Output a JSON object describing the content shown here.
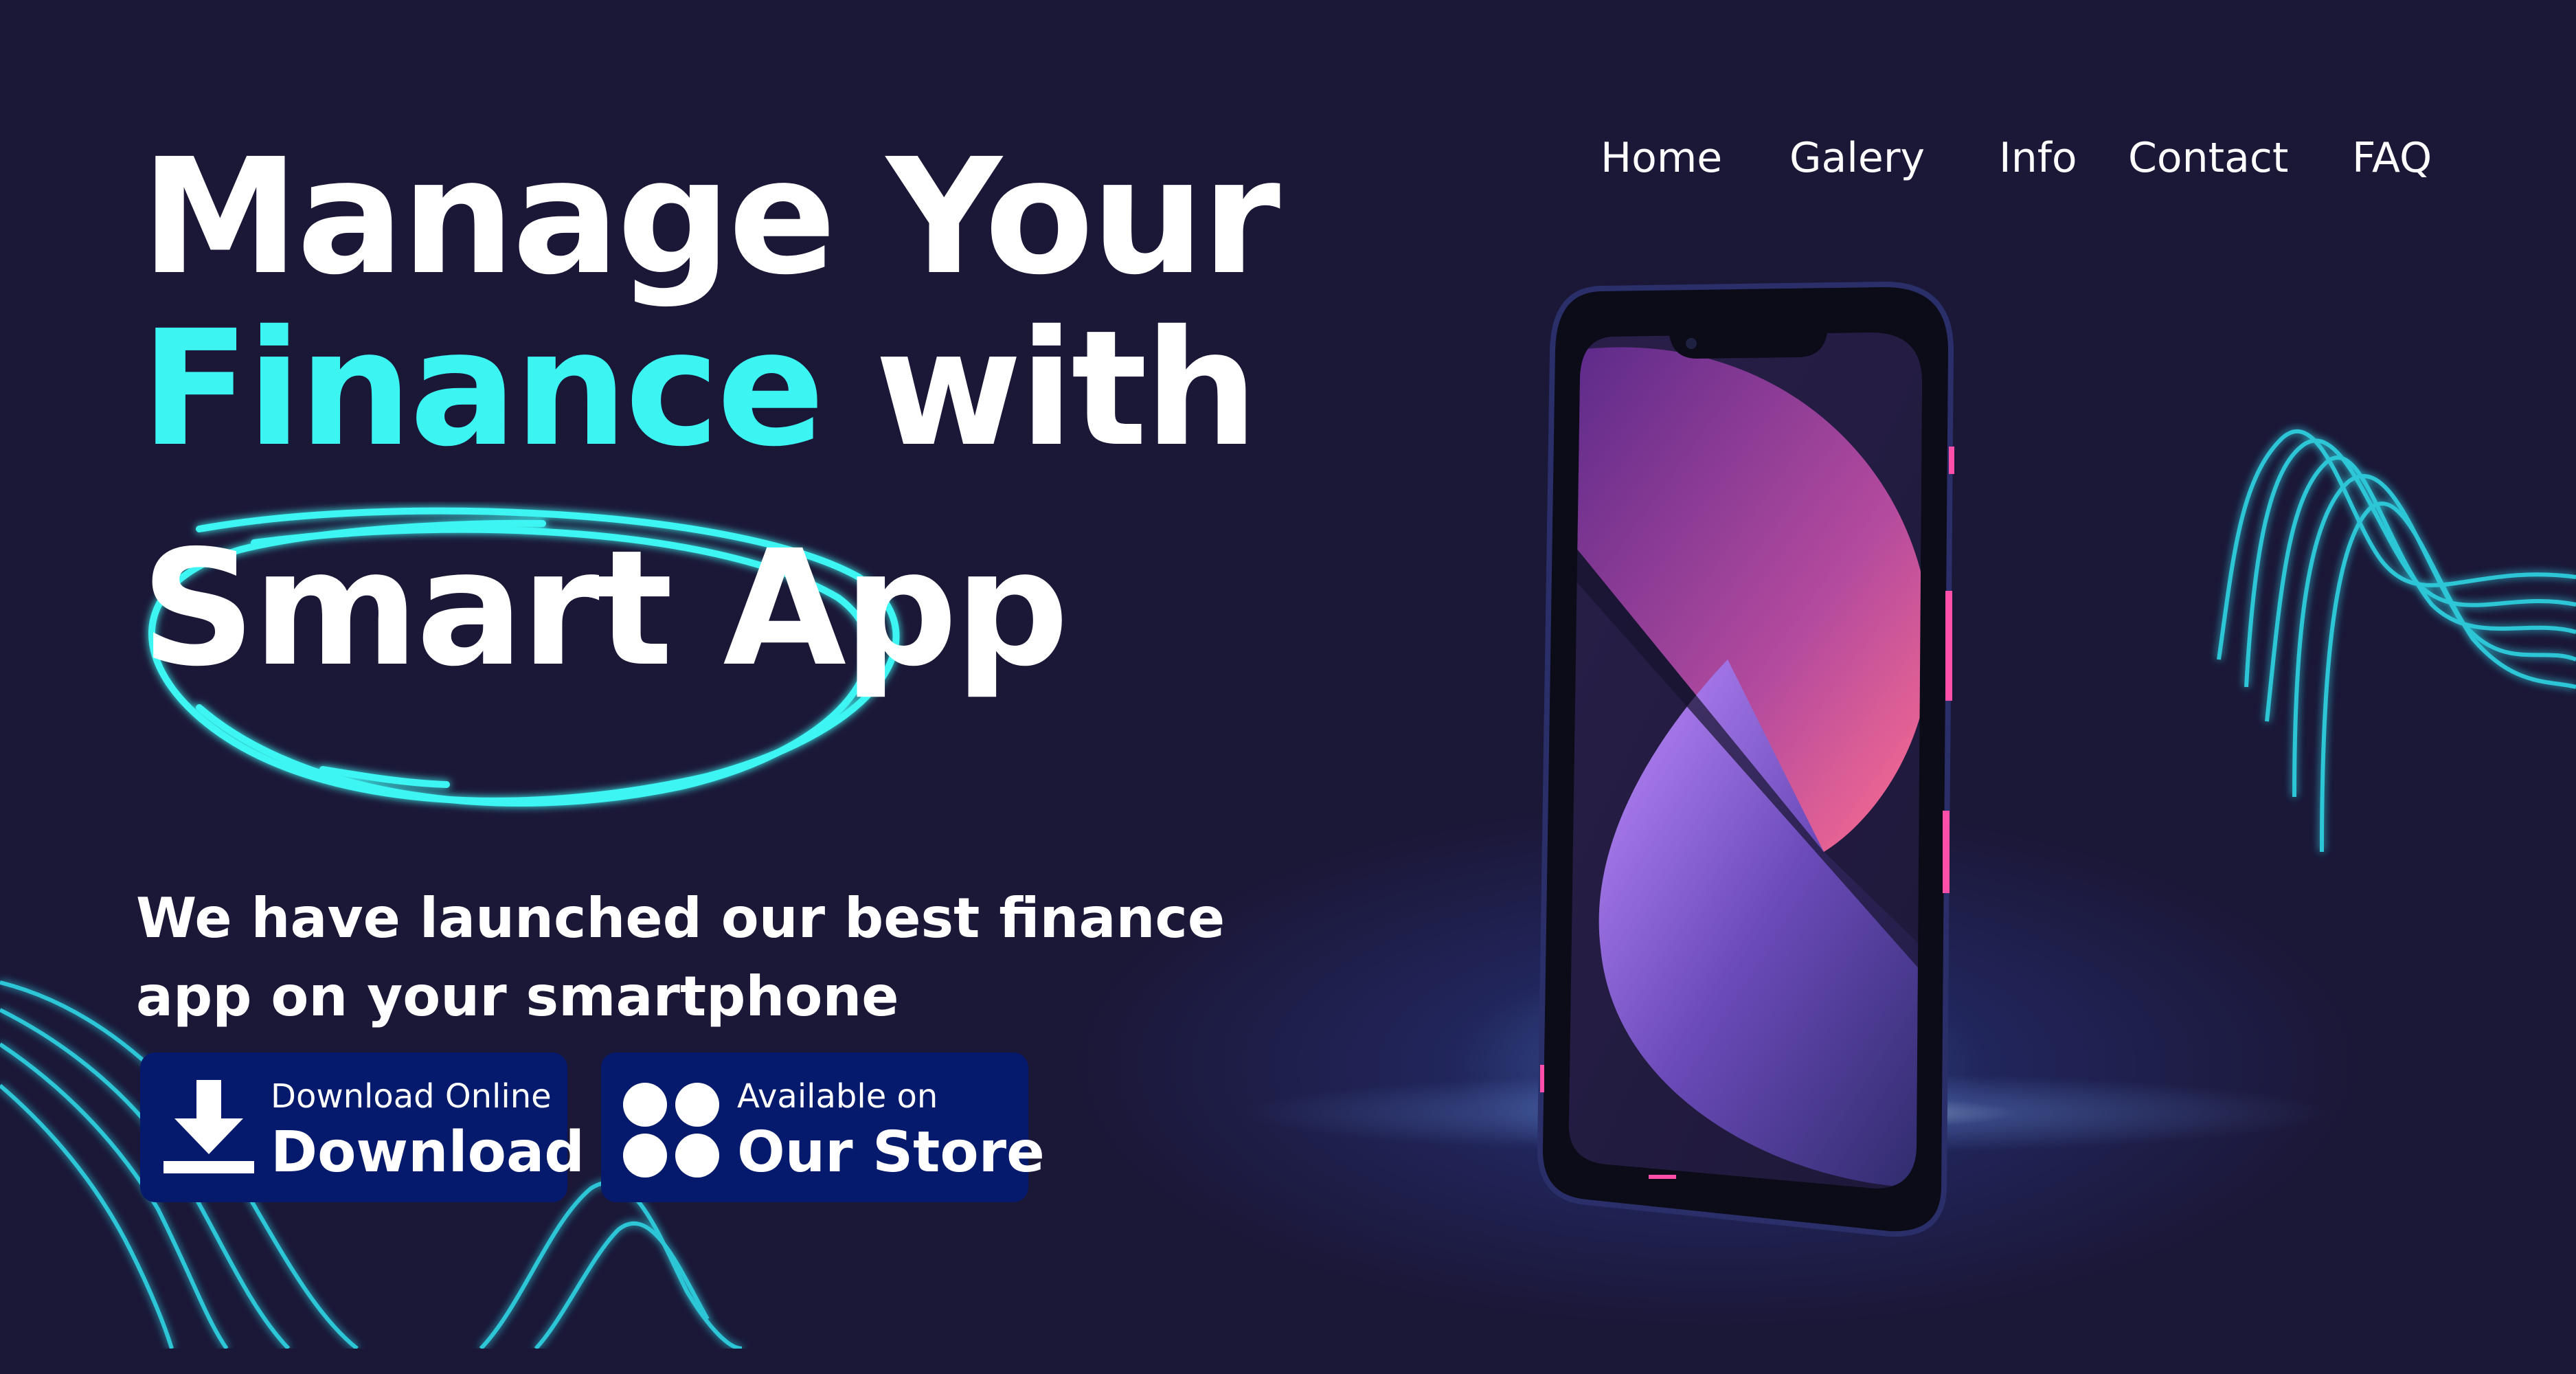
{
  "nav": {
    "items": [
      {
        "label": "Home"
      },
      {
        "label": "Galery"
      },
      {
        "label": "Info"
      },
      {
        "label": "Contact"
      },
      {
        "label": "FAQ"
      }
    ]
  },
  "hero": {
    "line1": "Manage Your",
    "line2_accent": "Finance",
    "line2_rest": " with",
    "line3": "Smart App",
    "subtitle_line1": "We have launched our best finance",
    "subtitle_line2": "app on your smartphone"
  },
  "buttons": {
    "download": {
      "small": "Download Online",
      "big": "Download",
      "icon": "download-icon"
    },
    "store": {
      "small": "Available on",
      "big": "Our Store",
      "icon": "store-dots-icon"
    }
  },
  "colors": {
    "background": "#1b1737",
    "accent": "#3cf5f2",
    "button": "#061a6d",
    "text": "#ffffff"
  }
}
